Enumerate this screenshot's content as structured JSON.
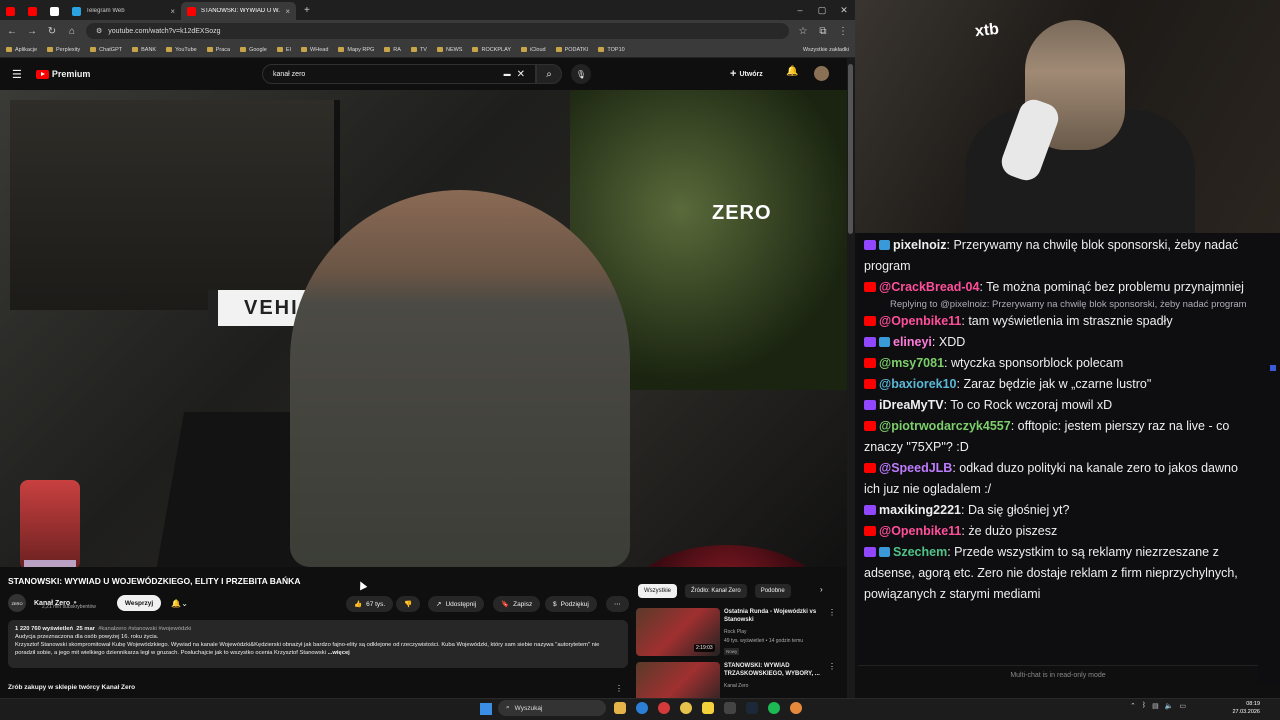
{
  "browser": {
    "tabs": [
      {
        "label": "",
        "favicon_color": "#ff0000"
      },
      {
        "label": "",
        "favicon_color": "#ff0000"
      },
      {
        "label": "",
        "favicon_color": "#ffffff"
      },
      {
        "label": "Telegram Web",
        "favicon_color": "#2aa3e0"
      },
      {
        "label": "STANOWSKI: WYWIAD U W...",
        "favicon_color": "#ff0000",
        "active": true
      }
    ],
    "new_tab": "+",
    "url": "youtube.com/watch?v=k12dEXSozg",
    "bookmarks": [
      "Aplikacje",
      "Perplexity",
      "ChatGPT",
      "BANK",
      "YouTube",
      "Praca",
      "Google",
      "EI",
      "WHead",
      "Mapy RPG",
      "RA",
      "TV",
      "NEWS",
      "ROCKPLAY",
      "iCloud",
      "PODATKI",
      "TOP10"
    ],
    "all_bookmarks": "Wszystkie zakładki"
  },
  "youtube": {
    "logo_text": "Premium",
    "search_value": "kanał zero",
    "create_label": "Utwórz",
    "video": {
      "overlay_brand": "ZERO",
      "sign_text": "VEHIS",
      "title": "STANOWSKI: WYWIAD U WOJEWÓDZKIEGO, ELITY I PRZEBITA BAŃKA",
      "channel": "Kanał Zero",
      "channel_avatar_text": "ZERO",
      "subs": "2,21 mln subskrybentów",
      "support_label": "Wesprzyj",
      "likes": "67 tys.",
      "share_label": "Udostępnij",
      "save_label": "Zapisz",
      "thanks_label": "Podziękuj",
      "views": "1 220 760 wyświetleń",
      "date": "25 mar",
      "tags": "#kanałzero #stanowski #wojewódzki",
      "desc_line1": "Audycja przeznaczona dla osób powyżej 16. roku życia.",
      "desc_line2": "Krzysztof Stanowski skompromitował Kubę Wojewódzkiego. Wywiad na kanale Wojewódzki&Kędzierski obnażył jak bardzo fajno-elity są odklejone od rzeczywistości. Kuba Wojewódzki, który sam siebie nazywa \"autorytetem\" nie poradził sobie, a jego mit wielkiego dziennikarza legł w gruzach. Posłuchajcie jak to wszystko ocenia Krzysztof Stanowski",
      "more": "...więcej",
      "shop": "Zrób zakupy w sklepie twórcy Kanał Zero"
    },
    "chips": [
      "Wszystkie",
      "Źródło: Kanał Zero",
      "Podobne"
    ],
    "recommendations": [
      {
        "title": "Ostatnia Runda - Wojewódzki vs Stanowski",
        "channel": "Rock Play",
        "views": "49 tys. wyświetleń • 14 godzin temu",
        "badge": "Nowy",
        "duration": "2:19:03"
      },
      {
        "title": "STANOWSKI: WYWIAD TRZASKOWSKIEGO, WYBORY, ...",
        "channel": "Kanał Zero",
        "views": "",
        "badge": "",
        "duration": ""
      }
    ]
  },
  "webcam": {
    "logo": "xtb"
  },
  "chat": {
    "messages": [
      {
        "platform": "twitch",
        "user": "pixelnoiz",
        "user_color": "#efeff1",
        "badge": true,
        "text": "Przerywamy na chwilę blok sponsorski, żeby nadać program"
      },
      {
        "platform": "youtube",
        "user": "@CrackBread-04",
        "user_color": "#ff4f9a",
        "text": "Te można pominąć bez problemu przynajmniej"
      },
      {
        "platform": "youtube",
        "user": "@Openbike11",
        "user_color": "#ff4f9a",
        "text": "tam wyświetlenia im strasznie spadły",
        "reply": "Replying to @pixelnoiz: Przerywamy na chwilę blok sponsorski, żeby nadać program"
      },
      {
        "platform": "twitch",
        "user": "elineyi",
        "user_color": "#ff7ad9",
        "badge": true,
        "text": "XDD"
      },
      {
        "platform": "youtube",
        "user": "@msy7081",
        "user_color": "#7ccf6b",
        "text": "wtyczka sponsorblock polecam"
      },
      {
        "platform": "youtube",
        "user": "@baxiorek10",
        "user_color": "#5bb7d6",
        "text": "Zaraz będzie jak w „czarne lustro\""
      },
      {
        "platform": "twitch",
        "user": "iDreaMyTV",
        "user_color": "#efeff1",
        "text": "To co Rock wczoraj mowil xD"
      },
      {
        "platform": "youtube",
        "user": "@piotrwodarczyk4557",
        "user_color": "#7ccf6b",
        "text": "offtopic: jestem pierszy raz na live - co znaczy \"75XP\"? :D"
      },
      {
        "platform": "youtube",
        "user": "@SpeedJLB",
        "user_color": "#c07cff",
        "text": "odkad duzo polityki na kanale zero to jakos dawno ich juz nie ogladalem :/"
      },
      {
        "platform": "twitch",
        "user": "maxiking2221",
        "user_color": "#efeff1",
        "text": "Da się głośniej yt?"
      },
      {
        "platform": "youtube",
        "user": "@Openbike11",
        "user_color": "#ff4f9a",
        "text": "że dużo piszesz"
      },
      {
        "platform": "twitch",
        "user": "Szechem",
        "user_color": "#4fc38a",
        "badge": true,
        "text": "Przede wszystkim to są reklamy niezrzeszane z adsense, agorą etc. Zero nie dostaje reklam z firm nieprzychylnych, powiązanych z starymi mediami"
      }
    ],
    "footer": "Multi-chat is in read-only mode"
  },
  "taskbar": {
    "search_label": "Wyszukaj",
    "time": "08:19",
    "date": "27.03.2026"
  }
}
